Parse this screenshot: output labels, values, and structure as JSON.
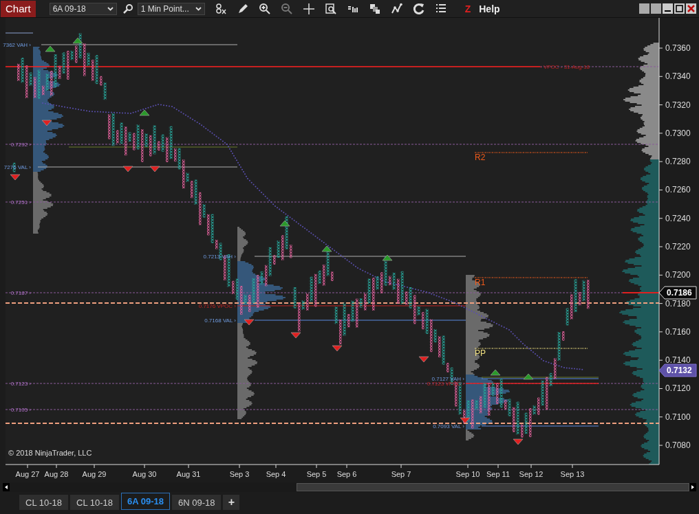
{
  "toolbar": {
    "title": "Chart",
    "instrument": "6A 09-18",
    "interval": "1 Min Point...",
    "z_label": "Z",
    "help": "Help"
  },
  "chart": {
    "price_axis": [
      "0.7360",
      "0.7340",
      "0.7320",
      "0.7300",
      "0.7280",
      "0.7260",
      "0.7240",
      "0.7220",
      "0.7200",
      "0.7180",
      "0.7160",
      "0.7140",
      "0.7120",
      "0.7100",
      "0.7080"
    ],
    "price_markers": [
      {
        "label": "0.7186",
        "kind": "last"
      },
      {
        "label": "0.7132",
        "kind": "vwap"
      }
    ],
    "date_axis": [
      "Aug 27",
      "Aug 28",
      "Aug 29",
      "Aug 30",
      "Aug 31",
      "Sep 3",
      "Sep 4",
      "Sep 5",
      "Sep 6",
      "Sep 7",
      "Sep 10",
      "Sep 11",
      "Sep 12",
      "Sep 13"
    ],
    "level_labels": [
      {
        "text": "7362 VAH ›",
        "kind": "vah"
      },
      {
        "text": "0.7292 ›",
        "kind": "level"
      },
      {
        "text": "7276 VAL ›",
        "kind": "val"
      },
      {
        "text": "0.7251 ›",
        "kind": "level"
      },
      {
        "text": "0.7187 ›",
        "kind": "level"
      },
      {
        "text": "0.7123 ›",
        "kind": "level"
      },
      {
        "text": "0.7105 ›",
        "kind": "level"
      },
      {
        "text": "0.7213 VAH ›",
        "kind": "vah"
      },
      {
        "text": "0.7176 VPOC ›",
        "kind": "vpoc"
      },
      {
        "text": "0.7168 VAL ›",
        "kind": "val"
      },
      {
        "text": "0.7127 VAH ›",
        "kind": "vah"
      },
      {
        "text": "0.7123 VPOC ›",
        "kind": "vpoc"
      },
      {
        "text": "0.7093 VAL ›",
        "kind": "val"
      }
    ],
    "vpoc_note": "‹ VPOC - 31-Aug-18",
    "pivots": [
      {
        "label": "R2",
        "kind": "resistance"
      },
      {
        "label": "R1",
        "kind": "resistance"
      },
      {
        "label": "PP",
        "kind": "pivot"
      }
    ],
    "copyright": "© 2018 NinjaTrader, LLC"
  },
  "tabs": [
    {
      "label": "CL 10-18",
      "selected": false
    },
    {
      "label": "CL 10-18",
      "selected": false
    },
    {
      "label": "6A 09-18",
      "selected": true
    },
    {
      "label": "6N 09-18",
      "selected": false
    }
  ],
  "add_tab": "+"
}
